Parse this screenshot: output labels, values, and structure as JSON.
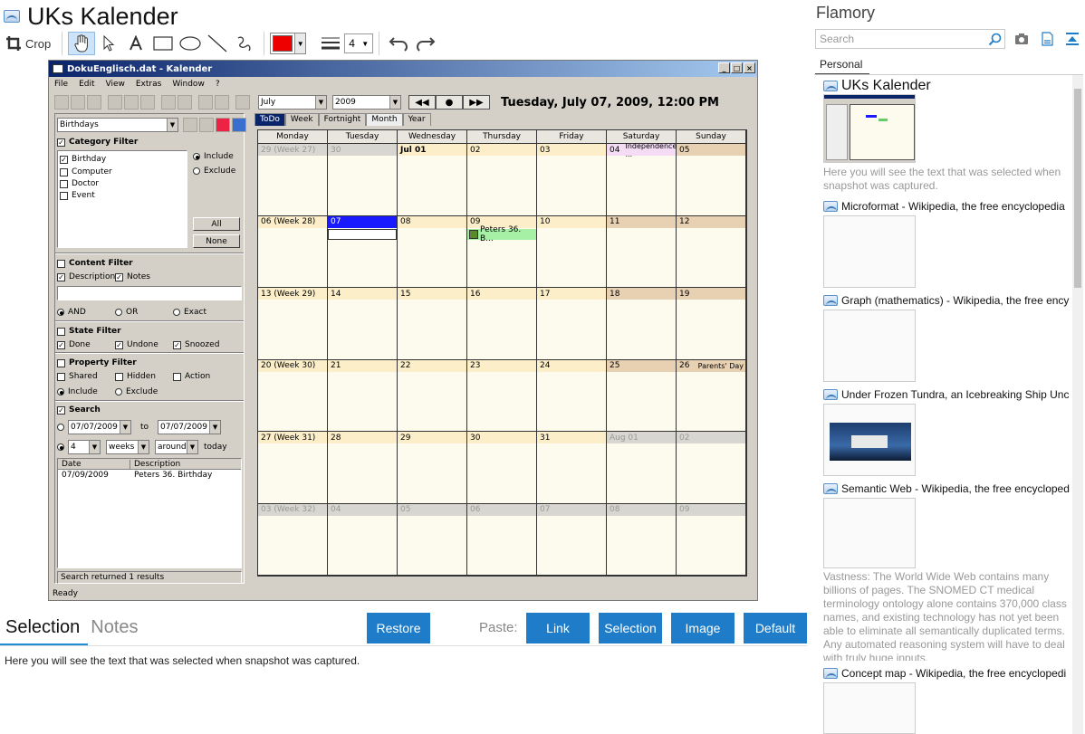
{
  "app": {
    "title": "UKs Kalender"
  },
  "toolbar": {
    "crop_label": "Crop",
    "line_width_value": "4",
    "color": "#ee0000"
  },
  "screenshot": {
    "window_title": "DokuEnglisch.dat - Kalender",
    "menu": [
      "File",
      "Edit",
      "View",
      "Extras",
      "Window",
      "?"
    ],
    "month_select": "July",
    "year_select": "2009",
    "big_date": "Tuesday, July 07, 2009, 12:00 PM",
    "filter": {
      "preset": "Birthdays",
      "category_filter": "Category Filter",
      "categories": [
        "Birthday",
        "Computer",
        "Doctor",
        "Event"
      ],
      "include": "Include",
      "exclude": "Exclude",
      "all_btn": "All",
      "none_btn": "None",
      "content_filter": "Content Filter",
      "description": "Description",
      "notes": "Notes",
      "and": "AND",
      "or": "OR",
      "exact": "Exact",
      "state_filter": "State Filter",
      "done": "Done",
      "undone": "Undone",
      "snoozed": "Snoozed",
      "property_filter": "Property Filter",
      "shared": "Shared",
      "hidden": "Hidden",
      "action": "Action",
      "include2": "Include",
      "exclude2": "Exclude",
      "search": "Search",
      "date_from": "07/07/2009",
      "to": "to",
      "date_to": "07/07/2009",
      "num": "4",
      "unit": "weeks",
      "around": "around",
      "today": "today",
      "col_date": "Date",
      "col_desc": "Description",
      "result_date": "07/09/2009",
      "result_desc": "Peters 36. Birthday",
      "search_status": "Search returned 1 results"
    },
    "tabs": [
      "ToDo",
      "Week",
      "Fortnight",
      "Month",
      "Year"
    ],
    "weekdays": [
      "Monday",
      "Tuesday",
      "Wednesday",
      "Thursday",
      "Friday",
      "Saturday",
      "Sunday"
    ],
    "weeks": [
      [
        "29 (Week 27)",
        "30",
        "Jul 01",
        "02",
        "03",
        "04",
        "05"
      ],
      [
        "06 (Week 28)",
        "07",
        "08",
        "09",
        "10",
        "11",
        "12"
      ],
      [
        "13 (Week 29)",
        "14",
        "15",
        "16",
        "17",
        "18",
        "19"
      ],
      [
        "20 (Week 30)",
        "21",
        "22",
        "23",
        "24",
        "25",
        "26"
      ],
      [
        "27 (Week 31)",
        "28",
        "29",
        "30",
        "31",
        "Aug 01",
        "02"
      ],
      [
        "03 (Week 32)",
        "04",
        "05",
        "06",
        "07",
        "08",
        "09"
      ]
    ],
    "event_independence": "Independence ...",
    "event_parents": "Parents' Day",
    "appointment": "Peters 36. B...",
    "status": "Ready"
  },
  "bottom": {
    "tab_selection": "Selection",
    "tab_notes": "Notes",
    "restore": "Restore",
    "paste_label": "Paste:",
    "link": "Link",
    "selection": "Selection",
    "image": "Image",
    "default": "Default",
    "selection_text": "Here you will see the text that was selected when snapshot was captured."
  },
  "right": {
    "title": "Flamory",
    "search_placeholder": "Search",
    "tab_personal": "Personal",
    "items": [
      {
        "title": "UKs Kalender",
        "desc": "Here you will see the text that was selected when snapshot was captured."
      },
      {
        "title": "Microformat - Wikipedia, the free encyclopedia"
      },
      {
        "title": "Graph (mathematics) - Wikipedia, the free ency"
      },
      {
        "title": "Under Frozen Tundra, an Icebreaking Ship Unco"
      },
      {
        "title": "Semantic Web - Wikipedia, the free encycloped",
        "desc": "Vastness: The World Wide Web contains many billions of pages. The SNOMED CT medical terminology ontology alone contains 370,000 class names, and existing technology has not yet been able to eliminate all semantically duplicated terms. Any automated reasoning system will have to deal with truly huge inputs."
      },
      {
        "title": "Concept map - Wikipedia, the free encyclopedi"
      }
    ]
  }
}
